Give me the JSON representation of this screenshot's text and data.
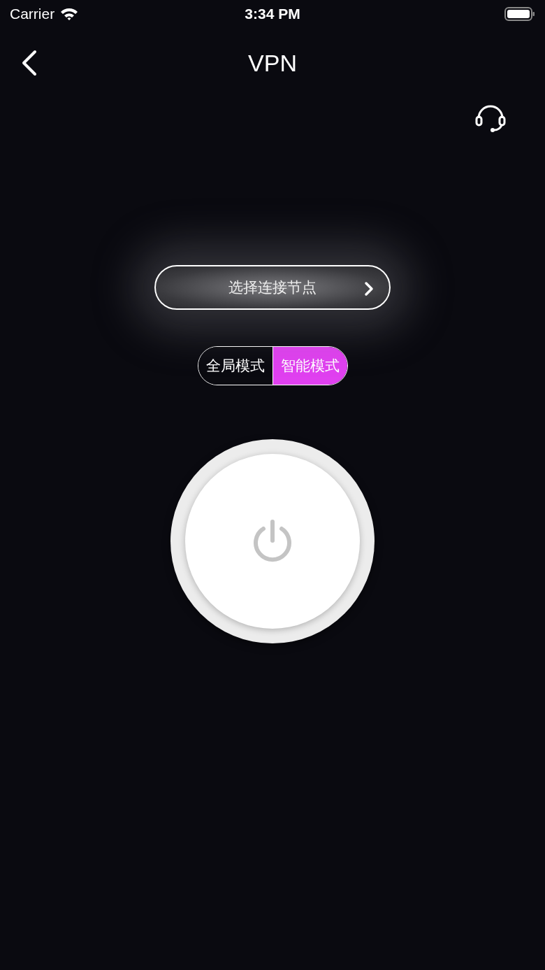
{
  "status_bar": {
    "carrier": "Carrier",
    "time": "3:34 PM"
  },
  "nav": {
    "title": "VPN"
  },
  "node_button": {
    "label": "选择连接节点"
  },
  "modes": [
    {
      "label": "全局模式",
      "selected": false
    },
    {
      "label": "智能模式",
      "selected": true
    }
  ],
  "power": {
    "on": false
  }
}
